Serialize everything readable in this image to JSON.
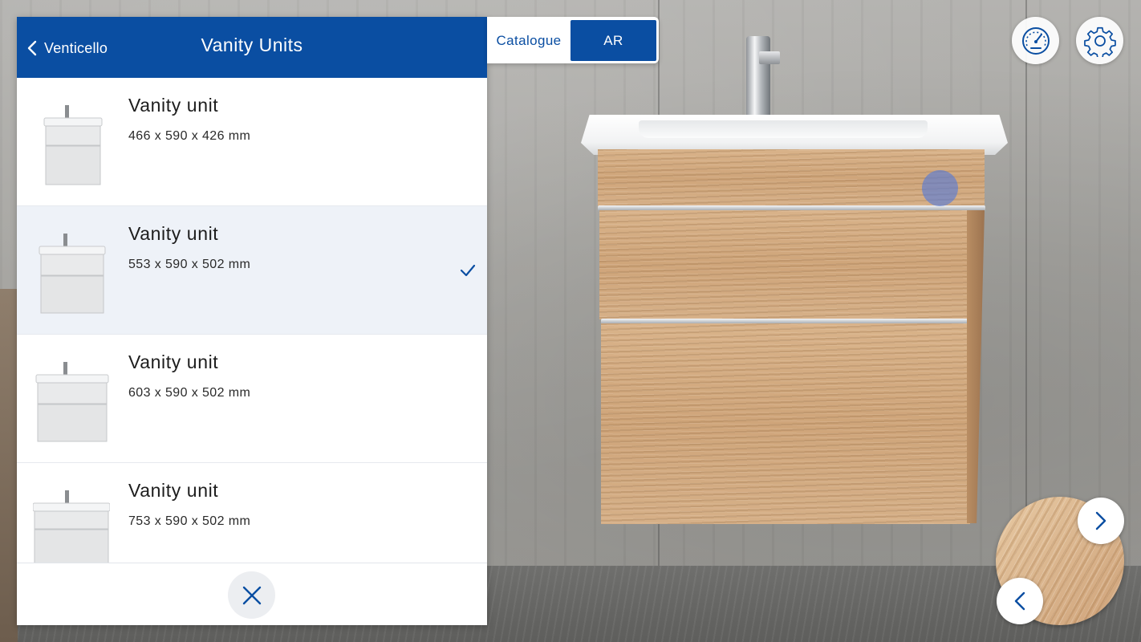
{
  "header": {
    "back_label": "Venticello",
    "title": "Vanity Units"
  },
  "mode_toggle": {
    "catalogue_label": "Catalogue",
    "ar_label": "AR",
    "active": "AR"
  },
  "products": [
    {
      "name": "Vanity unit",
      "dims": "466 x 590 x 426 mm",
      "selected": false
    },
    {
      "name": "Vanity unit",
      "dims": "553 x 590 x 502 mm",
      "selected": true
    },
    {
      "name": "Vanity unit",
      "dims": "603 x 590 x 502 mm",
      "selected": false
    },
    {
      "name": "Vanity unit",
      "dims": "753 x 590 x 502 mm",
      "selected": false
    }
  ],
  "icons": {
    "back": "chevron-left-icon",
    "selected": "checkmark-icon",
    "close": "close-icon",
    "performance": "gauge-icon",
    "settings": "gear-icon",
    "next": "chevron-right-icon",
    "previous": "chevron-left-icon"
  },
  "colors": {
    "brand_blue": "#0a4ea2",
    "selected_row": "#eef2f8"
  }
}
